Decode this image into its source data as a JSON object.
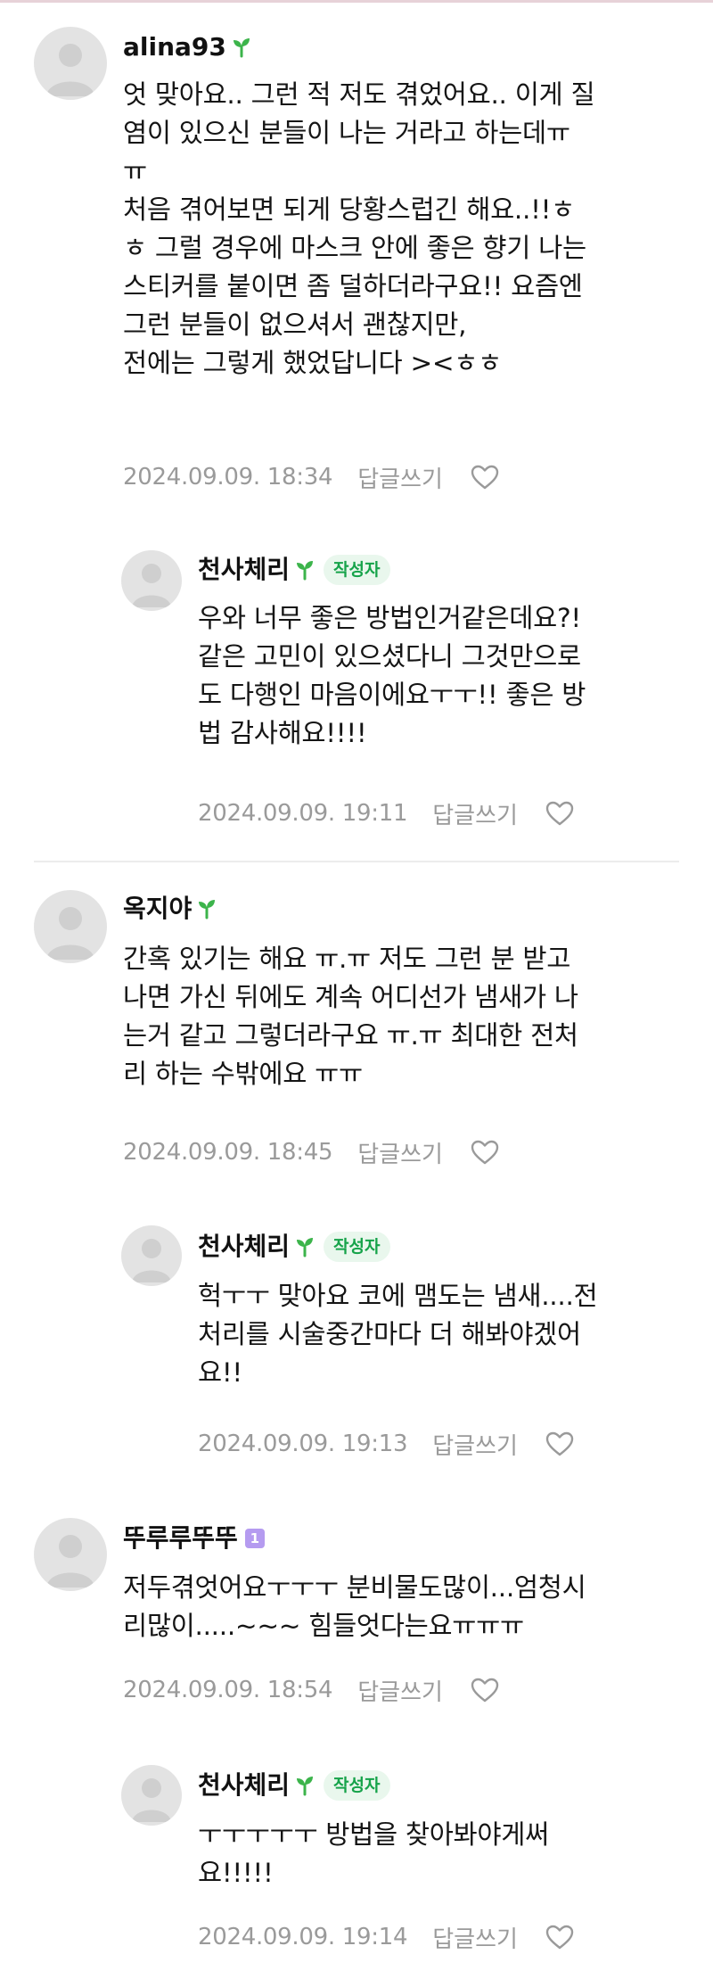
{
  "comments": [
    {
      "nickname": "alina93",
      "badge": "sprout",
      "lines": [
        "엇 맞아요.. 그런 적 저도 겪었어요.. 이게 질",
        "염이 있으신 분들이 나는 거라고 하는데ㅠ",
        "ㅠ",
        "처음 겪어보면 되게 당황스럽긴 해요..!!ㅎ",
        "ㅎ 그럴 경우에 마스크 안에 좋은 향기 나는",
        "스티커를 붙이면 좀 덜하더라구요!! 요즘엔",
        "그런 분들이 없으셔서 괜찮지만,",
        "전에는 그렇게 했었답니다 ><ㅎㅎ"
      ],
      "date": "2024.09.09. 18:34",
      "reply_label": "답글쓰기"
    },
    {
      "nickname": "천사체리",
      "badge": "sprout",
      "author_label": "작성자",
      "lines": [
        "우와 너무 좋은 방법인거같은데요?!",
        "같은 고민이 있으셨다니 그것만으로",
        "도 다행인 마음이에요ㅜㅜ!! 좋은 방",
        "법 감사해요!!!!"
      ],
      "date": "2024.09.09. 19:11",
      "reply_label": "답글쓰기"
    },
    {
      "nickname": "옥지야",
      "badge": "sprout",
      "lines": [
        "간혹 있기는 해요 ㅠ.ㅠ 저도 그런 분 받고",
        "나면 가신 뒤에도 계속 어디선가 냄새가 나",
        "는거 같고 그렇더라구요 ㅠ.ㅠ 최대한 전처",
        "리 하는 수밖에요 ㅠㅠ"
      ],
      "date": "2024.09.09. 18:45",
      "reply_label": "답글쓰기"
    },
    {
      "nickname": "천사체리",
      "badge": "sprout",
      "author_label": "작성자",
      "lines": [
        "헉ㅜㅜ 맞아요 코에 맴도는 냄새....전",
        "처리를 시술중간마다 더 해봐야겠어",
        "요!!"
      ],
      "date": "2024.09.09. 19:13",
      "reply_label": "답글쓰기"
    },
    {
      "nickname": "뚜루루뚜뚜",
      "badge": "rank",
      "rank_label": "1",
      "lines": [
        "저두겪엇어요ㅜㅜㅜ 분비물도많이...엄청시",
        "리많이.....~~~ 힘들엇다는요ㅠㅠㅠ"
      ],
      "date": "2024.09.09. 18:54",
      "reply_label": "답글쓰기"
    },
    {
      "nickname": "천사체리",
      "badge": "sprout",
      "author_label": "작성자",
      "lines": [
        "ㅜㅜㅜㅜㅜ 방법을 찾아봐야게써",
        "요!!!!!"
      ],
      "date": "2024.09.09. 19:14",
      "reply_label": "답글쓰기"
    }
  ],
  "colors": {
    "accent_green": "#16a34a",
    "author_badge_bg": "#e9f7ed",
    "rank_badge": "#b59bf0",
    "meta_gray": "#9a9a9a"
  }
}
